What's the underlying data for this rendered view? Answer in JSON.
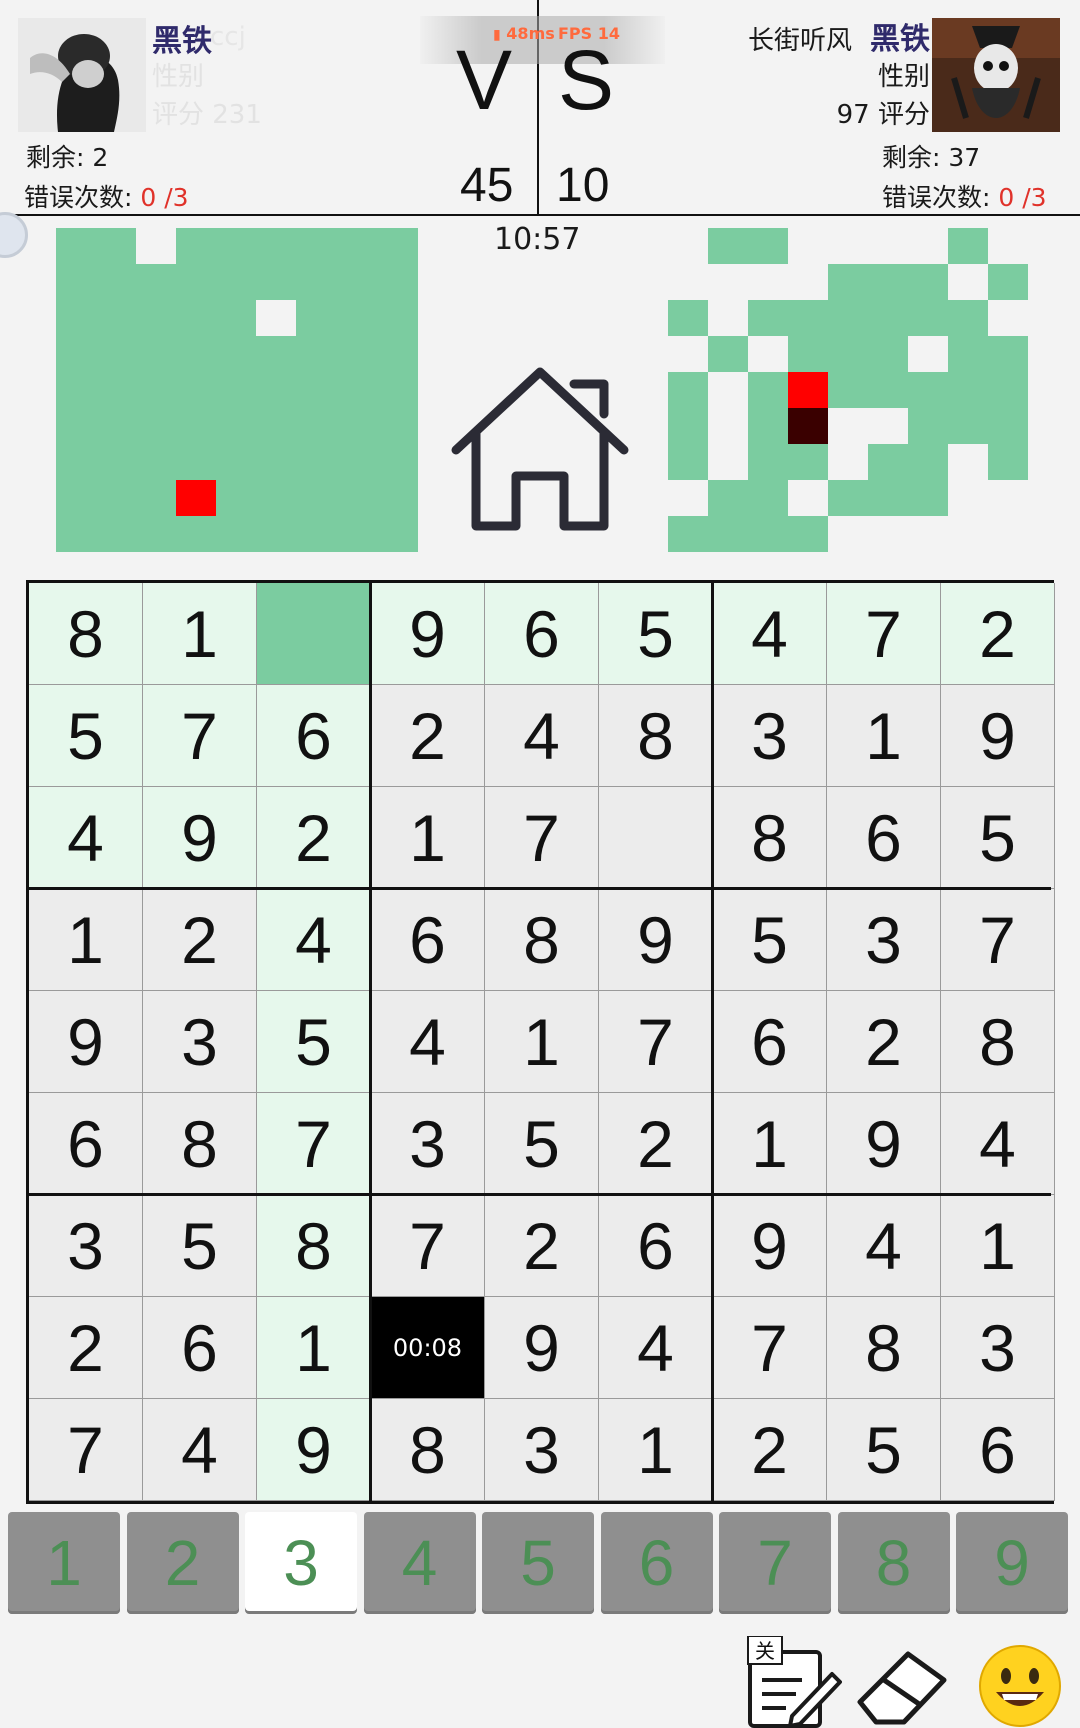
{
  "player1": {
    "name": "黑铁",
    "name_ghost": "ccj",
    "gender_label": "性别",
    "rating_text": "评分  231",
    "remaining_text": "剩余: 2",
    "errors_label": "错误次数:",
    "errors_value": "0 /3"
  },
  "player2": {
    "name_prefix": "长街听风",
    "name": "黑铁",
    "gender_label": "性别",
    "rating_text": "97 评分",
    "remaining_text": "剩余: 37",
    "errors_label": "错误次数:",
    "errors_value": "0 /3"
  },
  "vs": {
    "v": "V",
    "s": "S",
    "score_left": "45",
    "score_right": "10"
  },
  "network": {
    "ping": "48ms",
    "fps": "FPS 14"
  },
  "clock": "10:57",
  "colors": {
    "filled": "#7bcca0",
    "highlight": "#e6f8ec",
    "cell": "#ececec",
    "marker_red": "#ff0000",
    "marker_dark": "#3a0000",
    "number_green": "#4c8f55",
    "red_text": "#e0322a"
  },
  "board": {
    "rows": [
      [
        "8",
        "1",
        "",
        "9",
        "6",
        "5",
        "4",
        "7",
        "2"
      ],
      [
        "5",
        "7",
        "6",
        "2",
        "4",
        "8",
        "3",
        "1",
        "9"
      ],
      [
        "4",
        "9",
        "2",
        "1",
        "7",
        "",
        "8",
        "6",
        "5"
      ],
      [
        "1",
        "2",
        "4",
        "6",
        "8",
        "9",
        "5",
        "3",
        "7"
      ],
      [
        "9",
        "3",
        "5",
        "4",
        "1",
        "7",
        "6",
        "2",
        "8"
      ],
      [
        "6",
        "8",
        "7",
        "3",
        "5",
        "2",
        "1",
        "9",
        "4"
      ],
      [
        "3",
        "5",
        "8",
        "7",
        "2",
        "6",
        "9",
        "4",
        "1"
      ],
      [
        "2",
        "6",
        "1",
        "",
        "9",
        "4",
        "7",
        "8",
        "3"
      ],
      [
        "7",
        "4",
        "9",
        "8",
        "3",
        "1",
        "2",
        "5",
        "6"
      ]
    ],
    "selected_cell": [
      0,
      2
    ],
    "timer_cell": [
      7,
      3
    ],
    "timer_text": "00:08"
  },
  "numpad": {
    "keys": [
      "1",
      "2",
      "3",
      "4",
      "5",
      "6",
      "7",
      "8",
      "9"
    ],
    "active": "3"
  },
  "tools": {
    "notes_badge": "关"
  },
  "icons": {
    "home": "home-icon",
    "notes": "notes-pencil-icon",
    "eraser": "eraser-icon",
    "emoji": "smiley-emoji-icon"
  }
}
